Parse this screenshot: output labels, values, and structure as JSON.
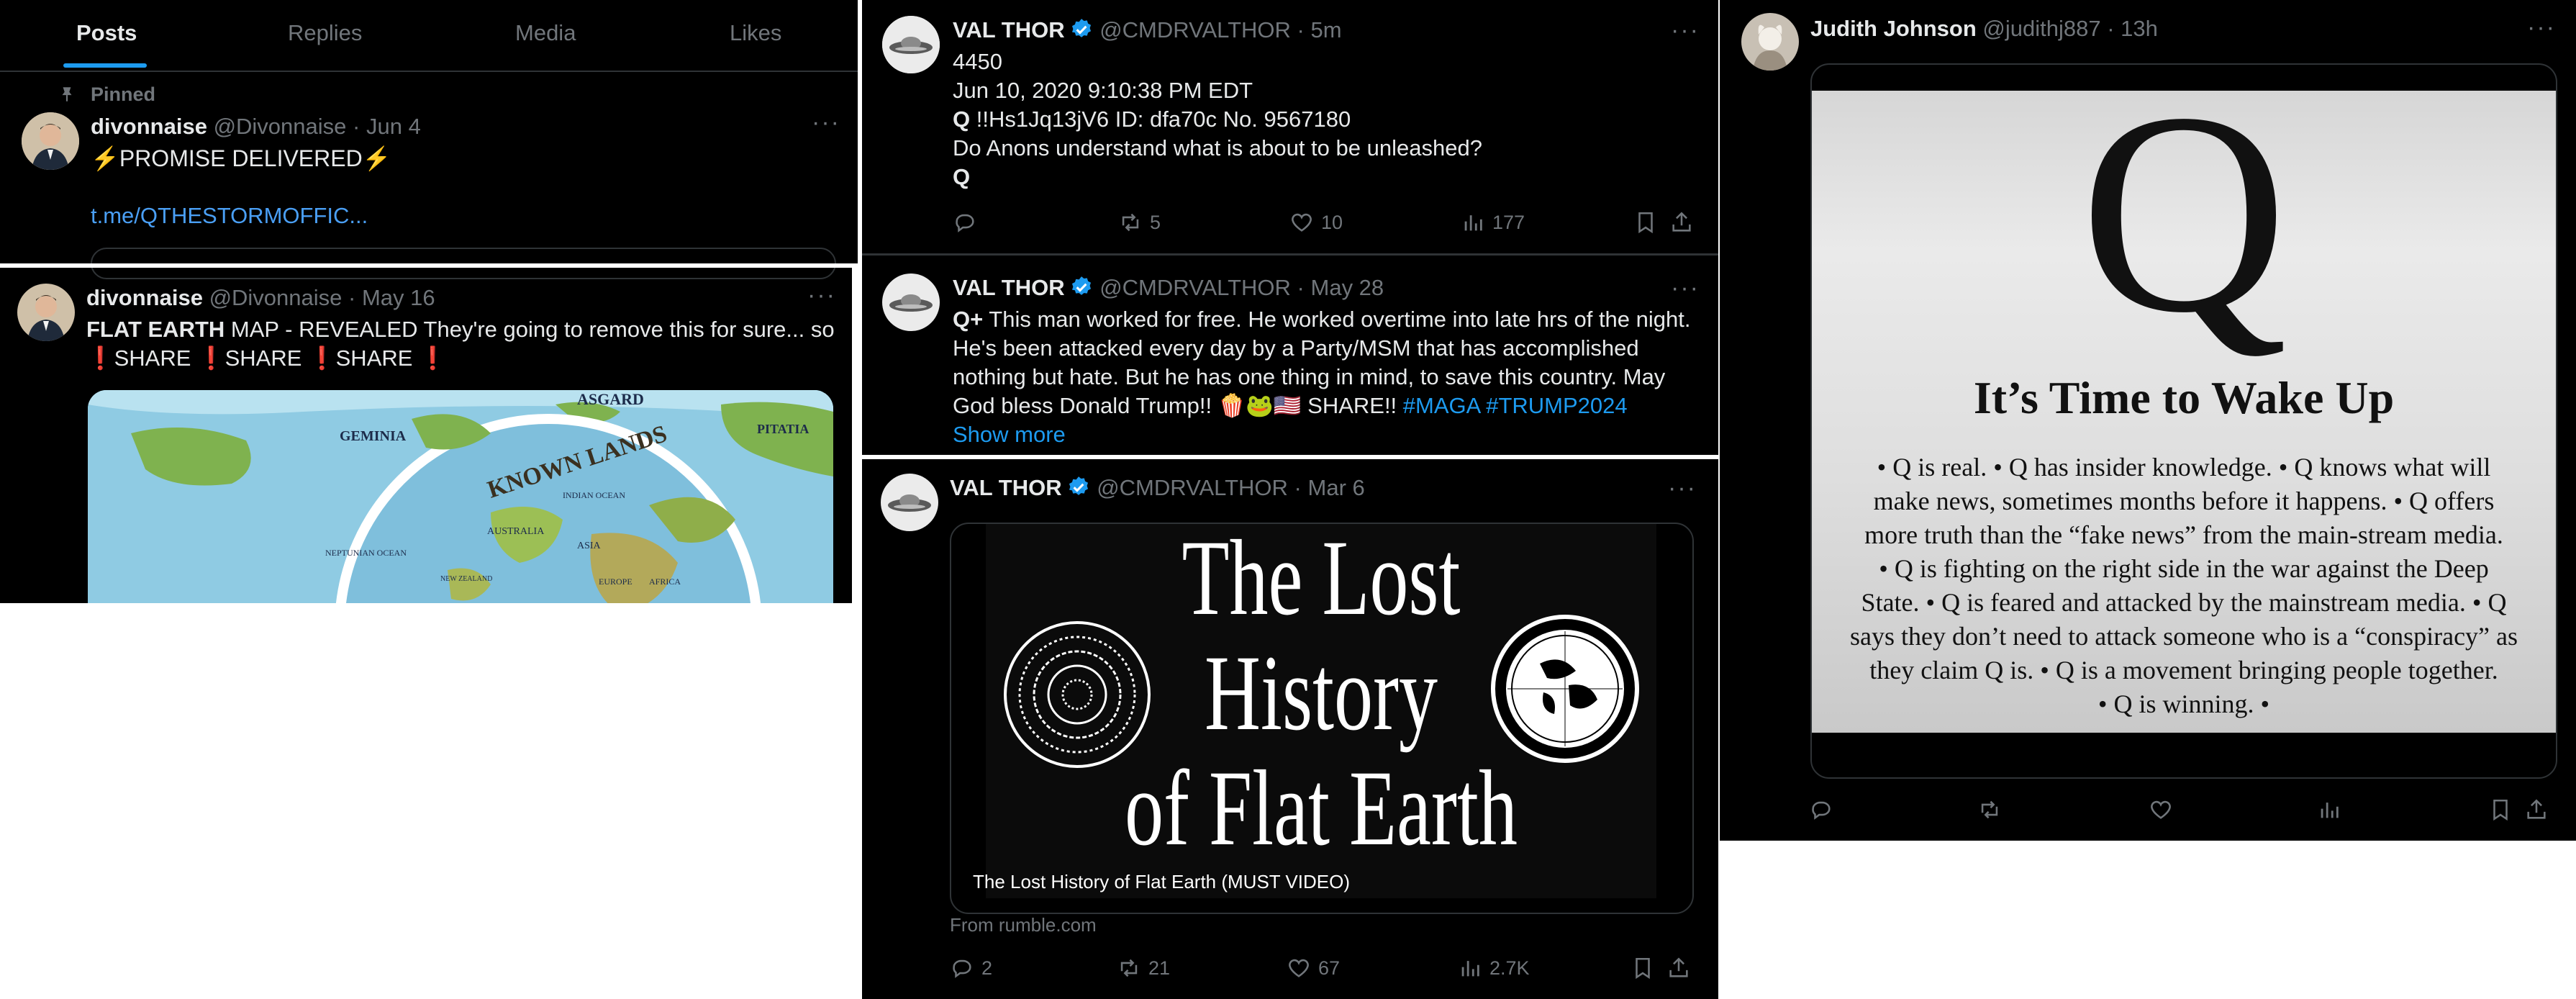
{
  "profile_tabs": [
    "Posts",
    "Replies",
    "Media",
    "Likes"
  ],
  "pinned_label": "Pinned",
  "tweets_left": [
    {
      "name": "divonnaise",
      "handle": "@Divonnaise",
      "time": "Jun 4",
      "text": "⚡PROMISE DELIVERED⚡",
      "link": "t.me/QTHESTORMOFFIC..."
    },
    {
      "name": "divonnaise",
      "handle": "@Divonnaise",
      "time": "May 16",
      "text_bold": "FLAT EARTH",
      "text": " MAP - REVEALED They're going to remove this for sure... so",
      "text2": "❗SHARE ❗SHARE ❗SHARE ❗",
      "map_labels": [
        "ASGARD",
        "GEMINIA",
        "PITATIA",
        "KNOWN LANDS",
        "NEPTUNIAN OCEAN",
        "INDIAN OCEAN",
        "AUSTRALIA",
        "ASIA",
        "EUROPE",
        "AFRICA",
        "NEW ZEALAND"
      ]
    }
  ],
  "tweets_mid": [
    {
      "name": "VAL THOR",
      "handle": "@CMDRVALTHOR",
      "time": "5m",
      "lines": [
        "4450",
        "Jun 10, 2020 9:10:38 PM EDT"
      ],
      "q_line_bold": "Q",
      "q_line": " !!Hs1Jq13jV6 ID: dfa70c No. 9567180",
      "line4": "Do Anons understand what is about to be unleashed?",
      "sign": "Q",
      "stats": {
        "replies": "",
        "reposts": "5",
        "likes": "10",
        "views": "177"
      }
    },
    {
      "name": "VAL THOR",
      "handle": "@CMDRVALTHOR",
      "time": "May 28",
      "bold_prefix": "Q+",
      "text": " This man worked for free. He worked overtime into late hrs of the night. He's been attacked every day by a Party/MSM that has accomplished nothing but hate. But he has one thing in mind, to save this country. May God bless Donald Trump!! 🍿🐸🇺🇸 SHARE!! ",
      "hashtags": "#MAGA #TRUMP2024",
      "show_more": "Show more"
    },
    {
      "name": "VAL THOR",
      "handle": "@CMDRVALTHOR",
      "time": "Mar 6",
      "card_title_lines": [
        "The Lost",
        "History",
        "of Flat Earth"
      ],
      "card_caption": "The Lost History of Flat Earth (MUST VIDEO)",
      "card_source": "From rumble.com",
      "stats": {
        "replies": "2",
        "reposts": "21",
        "likes": "67",
        "views": "2.7K"
      }
    }
  ],
  "tweet_right": {
    "name": "Judith Johnson",
    "handle": "@judithj887",
    "time": "13h",
    "poster_letter": "Q",
    "poster_title": "It’s Time to Wake Up",
    "poster_lines": [
      "• Q is real. • Q has insider knowledge. • Q knows what will",
      "make news, sometimes months before it happens. • Q offers",
      "more truth than the “fake news” from the main-stream media.",
      "• Q is fighting on the right side in the war against the Deep",
      "State. • Q is feared and attacked by the mainstream media. • Q",
      "says they don’t need to attack someone who is a “conspiracy” as",
      "they claim Q is. • Q is a movement bringing people together.",
      "• Q is winning. •"
    ]
  },
  "colors": {
    "background": "#000000",
    "text": "#e7e9ea",
    "muted": "#71767b",
    "accent": "#1d9bf0",
    "verified": "#1d9bf0"
  }
}
